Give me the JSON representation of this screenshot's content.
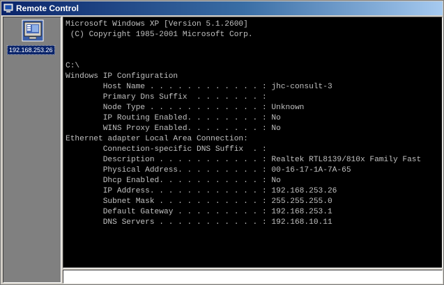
{
  "window": {
    "title": "Remote Control"
  },
  "sidebar": {
    "hosts": [
      {
        "label": "192.168.253.26",
        "icon": "computer-monitor-icon",
        "selected": true
      }
    ]
  },
  "console": {
    "lines": [
      "Microsoft Windows XP [Version 5.1.2600]",
      " (C) Copyright 1985-2001 Microsoft Corp.",
      "",
      "",
      "C:\\",
      "Windows IP Configuration",
      "        Host Name . . . . . . . . . . . . : jhc-consult-3",
      "        Primary Dns Suffix  . . . . . . . :",
      "        Node Type . . . . . . . . . . . . : Unknown",
      "        IP Routing Enabled. . . . . . . . : No",
      "        WINS Proxy Enabled. . . . . . . . : No",
      "Ethernet adapter Local Area Connection:",
      "        Connection-specific DNS Suffix  . :",
      "        Description . . . . . . . . . . . : Realtek RTL8139/810x Family Fast",
      "        Physical Address. . . . . . . . . : 00-16-17-1A-7A-65",
      "        Dhcp Enabled. . . . . . . . . . . : No",
      "        IP Address. . . . . . . . . . . . : 192.168.253.26",
      "        Subnet Mask . . . . . . . . . . . : 255.255.255.0",
      "        Default Gateway . . . . . . . . . : 192.168.253.1",
      "        DNS Servers . . . . . . . . . . . : 192.168.10.11"
    ]
  },
  "command_input": {
    "value": ""
  },
  "colors": {
    "titlebar_start": "#0a246a",
    "titlebar_end": "#a6caf0",
    "console_background": "#000000",
    "console_text": "#c0c0c0",
    "selection": "#0a246a"
  }
}
